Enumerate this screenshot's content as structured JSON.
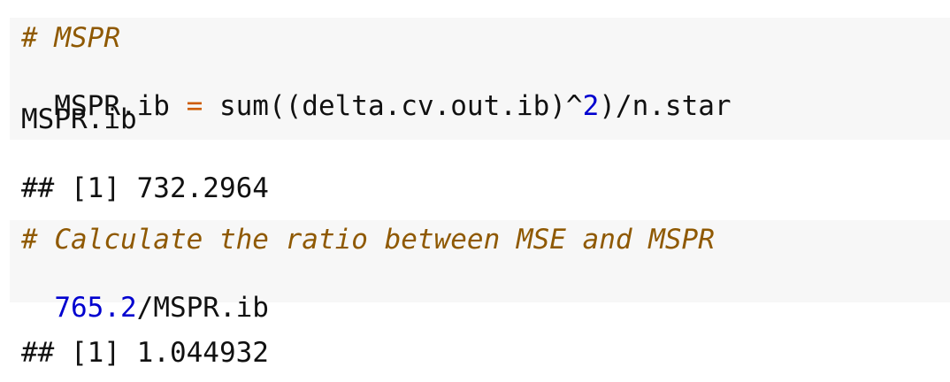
{
  "blocks": [
    {
      "type": "code",
      "lines": [
        {
          "comment": "# MSPR"
        },
        {
          "pre": "MSPR.ib ",
          "op": "=",
          "mid": " sum((delta.cv.out.ib)",
          "caret": "^",
          "num": "2",
          "post": ")/n.star"
        },
        {
          "text": "MSPR.ib"
        }
      ]
    },
    {
      "type": "output",
      "text": "## [1] 732.2964"
    },
    {
      "type": "code",
      "lines": [
        {
          "comment": "# Calculate the ratio between MSE and MSPR"
        },
        {
          "num": "765.2",
          "post": "/MSPR.ib"
        }
      ]
    },
    {
      "type": "output",
      "text": "## [1] 1.044932"
    }
  ],
  "colors": {
    "code_background": "#f7f7f7",
    "comment": "#8f5902",
    "number": "#0000cf",
    "operator": "#ce5c00",
    "text": "#111111"
  }
}
